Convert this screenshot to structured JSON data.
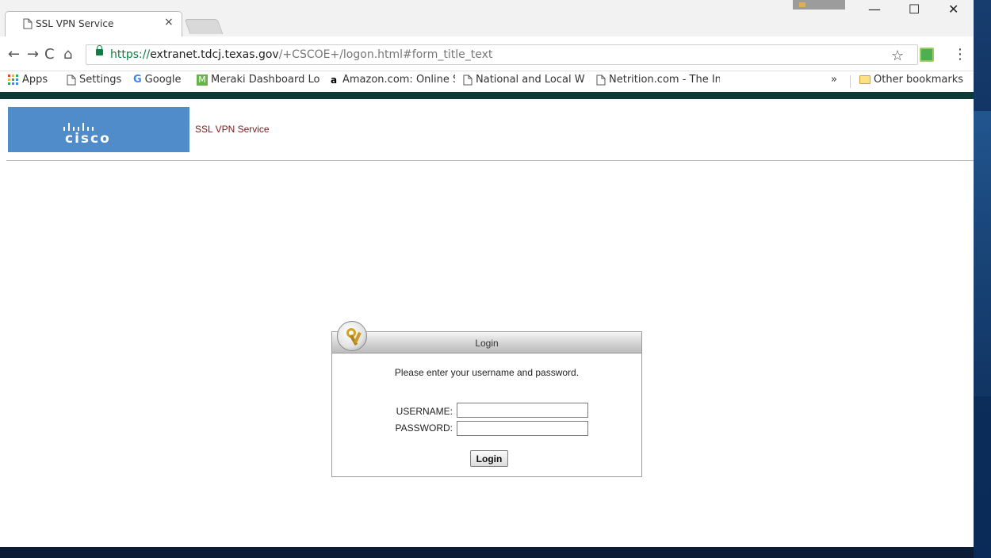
{
  "browser": {
    "tab_title": "SSL VPN Service",
    "tab_close": "×",
    "url_scheme": "https://",
    "url_host": "extranet.tdcj.texas.gov",
    "url_path": "/+CSCOE+/logon.html#form_title_text",
    "nav": {
      "back": "←",
      "forward": "→",
      "reload": "C",
      "home": "⌂"
    },
    "star": "☆",
    "menu": "⋮",
    "window_controls": {
      "minimize": "—",
      "maximize": "☐",
      "close": "✕"
    }
  },
  "bookmarks": {
    "items": [
      {
        "label": "Apps",
        "icon": "apps-icon"
      },
      {
        "label": "Settings",
        "icon": "page-icon"
      },
      {
        "label": "Google",
        "icon": "google-icon"
      },
      {
        "label": "Meraki Dashboard Lo",
        "icon": "meraki-icon"
      },
      {
        "label": "Amazon.com: Online S",
        "icon": "amazon-icon"
      },
      {
        "label": "National and Local W",
        "icon": "page-icon"
      },
      {
        "label": "Netrition.com - The In",
        "icon": "page-icon"
      }
    ],
    "overflow": "»",
    "other": "Other bookmarks"
  },
  "page": {
    "brand": "CISCO",
    "service_title": "SSL VPN Service",
    "login": {
      "title": "Login",
      "prompt": "Please enter your username and password.",
      "username_label": "USERNAME:",
      "password_label": "PASSWORD:",
      "username_value": "",
      "password_value": "",
      "button": "Login"
    }
  },
  "colors": {
    "brand_bar": "#0e3b36",
    "cisco_blue": "#4f8cc9",
    "title_red": "#7a1b1b"
  }
}
